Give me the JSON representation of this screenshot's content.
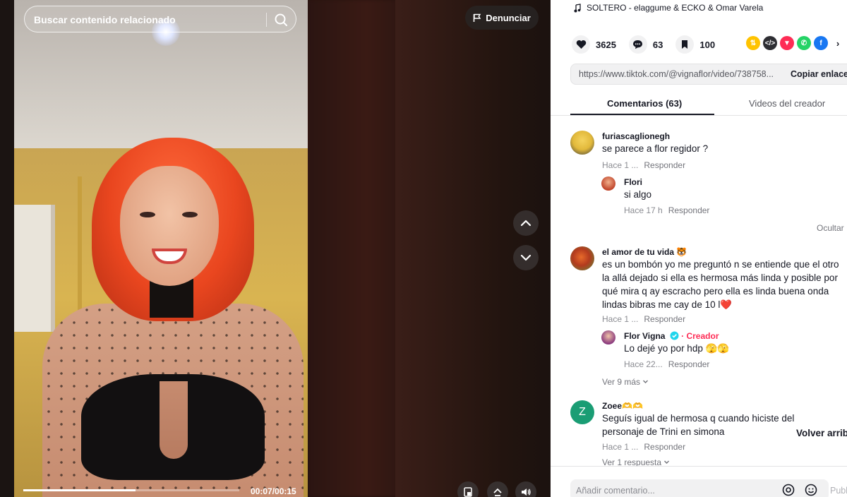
{
  "search": {
    "placeholder": "Buscar contenido relacionado"
  },
  "report": {
    "label": "Denunciar"
  },
  "player": {
    "time": "00:07/00:15",
    "progress": 0.52
  },
  "music": {
    "title": "SOLTERO - elaggume & ECKO & Omar Varela"
  },
  "stats": {
    "likes": "3625",
    "comments": "63",
    "saves": "100"
  },
  "share_icons": [
    "repost-icon",
    "embed-icon",
    "send-icon",
    "whatsapp-icon",
    "facebook-icon"
  ],
  "link": {
    "url": "https://www.tiktok.com/@vignaflor/video/738758...",
    "copy_label": "Copiar enlace"
  },
  "tabs": {
    "comments": "Comentarios (63)",
    "creator_videos": "Videos del creador"
  },
  "comments": [
    {
      "user": "furiascaglionegh",
      "text": "se parece a flor regidor ?",
      "time": "Hace 1 ...",
      "reply_label": "Responder",
      "replies": [
        {
          "user": "Flori",
          "text": "si algo",
          "time": "Hace 17 h",
          "reply_label": "Responder"
        }
      ],
      "hide_label": "Ocultar"
    },
    {
      "user": "el amor de tu vida 🐯",
      "text": "es un bombón yo me preguntó n se entiende que el otro la allá dejado si ella es hermosa más linda y posible por qué mira q ay escracho pero ella es linda buena onda lindas bibras me cay de 10 l❤️",
      "time": "Hace 1 ...",
      "reply_label": "Responder",
      "replies": [
        {
          "user": "Flor Vigna",
          "badge": "· Creador",
          "text": "Lo dejé yo por hdp 🫣🫣",
          "time": "Hace 22...",
          "reply_label": "Responder"
        }
      ],
      "more_label": "Ver 9 más"
    },
    {
      "user": "Zoee🫶🫶",
      "avatar_letter": "Z",
      "text": "Seguís igual de hermosa q cuando hiciste del personaje de Trini en simona",
      "time": "Hace 1 ...",
      "reply_label": "Responder",
      "more_label": "Ver 1 respuesta"
    }
  ],
  "back_to_top": "Volver arriba",
  "composer": {
    "placeholder": "Añadir comentario...",
    "post_label": "Publicar"
  },
  "colors": {
    "accent": "#fe2c55",
    "verified": "#20d5ec",
    "text": "#161823",
    "muted": "#8a8b91"
  }
}
